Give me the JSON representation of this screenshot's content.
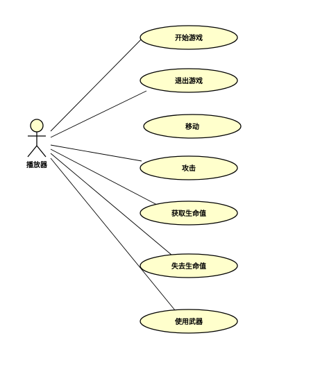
{
  "actor": {
    "label": "播放器"
  },
  "use_cases": [
    {
      "id": "start-game",
      "label": "开始游戏"
    },
    {
      "id": "exit-game",
      "label": "退出游戏"
    },
    {
      "id": "move",
      "label": "移动"
    },
    {
      "id": "attack",
      "label": "攻击"
    },
    {
      "id": "gain-health",
      "label": "获取生命值"
    },
    {
      "id": "lose-health",
      "label": "失去生命值"
    },
    {
      "id": "use-weapon",
      "label": "使用武器"
    }
  ],
  "associations": [
    {
      "actor": "actor",
      "use_case": "start-game"
    },
    {
      "actor": "actor",
      "use_case": "exit-game"
    },
    {
      "actor": "actor",
      "use_case": "attack"
    },
    {
      "actor": "actor",
      "use_case": "gain-health"
    },
    {
      "actor": "actor",
      "use_case": "lose-health"
    },
    {
      "actor": "actor",
      "use_case": "use-weapon"
    }
  ],
  "colors": {
    "fill": "#ffffcc",
    "stroke": "#000000"
  }
}
